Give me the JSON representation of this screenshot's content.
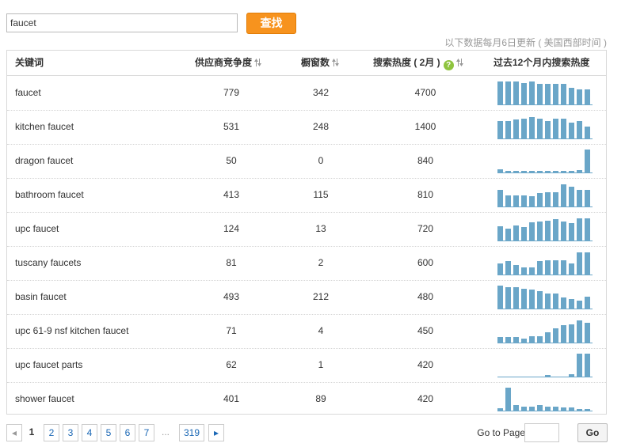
{
  "search": {
    "value": "faucet",
    "button_label": "查找"
  },
  "update_note": "以下数据每月6日更新 ( 美国西部时间 )",
  "table": {
    "headers": {
      "keyword": "关键词",
      "competition": "供应商竞争度",
      "showcase": "橱窗数",
      "heat": "搜索热度 ( 2月 )",
      "trend": "过去12个月内搜索热度"
    },
    "rows": [
      {
        "keyword": "faucet",
        "competition": "779",
        "showcase": "342",
        "heat": "4700",
        "trend": [
          0.95,
          0.95,
          0.95,
          0.88,
          0.95,
          0.85,
          0.85,
          0.85,
          0.85,
          0.7,
          0.62,
          0.62
        ]
      },
      {
        "keyword": "kitchen faucet",
        "competition": "531",
        "showcase": "248",
        "heat": "1400",
        "trend": [
          0.72,
          0.72,
          0.78,
          0.82,
          0.88,
          0.82,
          0.72,
          0.82,
          0.82,
          0.65,
          0.72,
          0.5
        ]
      },
      {
        "keyword": "dragon faucet",
        "competition": "50",
        "showcase": "0",
        "heat": "840",
        "trend": [
          0.17,
          0.1,
          0.1,
          0.1,
          0.1,
          0.1,
          0.1,
          0.1,
          0.1,
          0.1,
          0.14,
          0.95
        ]
      },
      {
        "keyword": "bathroom faucet",
        "competition": "413",
        "showcase": "115",
        "heat": "810",
        "trend": [
          0.68,
          0.48,
          0.48,
          0.48,
          0.45,
          0.55,
          0.6,
          0.6,
          0.92,
          0.8,
          0.68,
          0.68
        ]
      },
      {
        "keyword": "upc faucet",
        "competition": "124",
        "showcase": "13",
        "heat": "720",
        "trend": [
          0.6,
          0.5,
          0.62,
          0.55,
          0.75,
          0.78,
          0.82,
          0.88,
          0.78,
          0.72,
          0.92,
          0.92
        ]
      },
      {
        "keyword": "tuscany faucets",
        "competition": "81",
        "showcase": "2",
        "heat": "600",
        "trend": [
          0.48,
          0.55,
          0.4,
          0.3,
          0.32,
          0.55,
          0.58,
          0.58,
          0.58,
          0.48,
          0.9,
          0.92
        ]
      },
      {
        "keyword": "basin faucet",
        "competition": "493",
        "showcase": "212",
        "heat": "480",
        "trend": [
          0.95,
          0.88,
          0.88,
          0.82,
          0.78,
          0.72,
          0.62,
          0.62,
          0.48,
          0.42,
          0.35,
          0.5
        ]
      },
      {
        "keyword": "upc 61-9 nsf kitchen faucet",
        "competition": "71",
        "showcase": "4",
        "heat": "450",
        "trend": [
          0.25,
          0.25,
          0.25,
          0.2,
          0.28,
          0.28,
          0.45,
          0.6,
          0.72,
          0.75,
          0.92,
          0.82
        ]
      },
      {
        "keyword": "upc faucet parts",
        "competition": "62",
        "showcase": "1",
        "heat": "420",
        "trend": [
          0.02,
          0.02,
          0.02,
          0.02,
          0.02,
          0.02,
          0.08,
          0.02,
          0.02,
          0.12,
          0.95,
          0.95
        ]
      },
      {
        "keyword": "shower faucet",
        "competition": "401",
        "showcase": "89",
        "heat": "420",
        "trend": [
          0.12,
          0.95,
          0.25,
          0.2,
          0.2,
          0.25,
          0.2,
          0.2,
          0.15,
          0.15,
          0.1,
          0.08
        ]
      }
    ]
  },
  "pager": {
    "pages": [
      "1",
      "2",
      "3",
      "4",
      "5",
      "6",
      "7"
    ],
    "current": "1",
    "ellipsis": "...",
    "last": "319"
  },
  "goto": {
    "label": "Go to Page",
    "value": "",
    "button_label": "Go"
  },
  "colors": {
    "accent": "#f7931e",
    "bar": "#6aa6c8",
    "link": "#1a67b5"
  },
  "icons": {
    "sort": "sort-arrows-icon",
    "help": "help-icon",
    "prev": "arrow-left-icon",
    "next": "arrow-right-icon"
  }
}
